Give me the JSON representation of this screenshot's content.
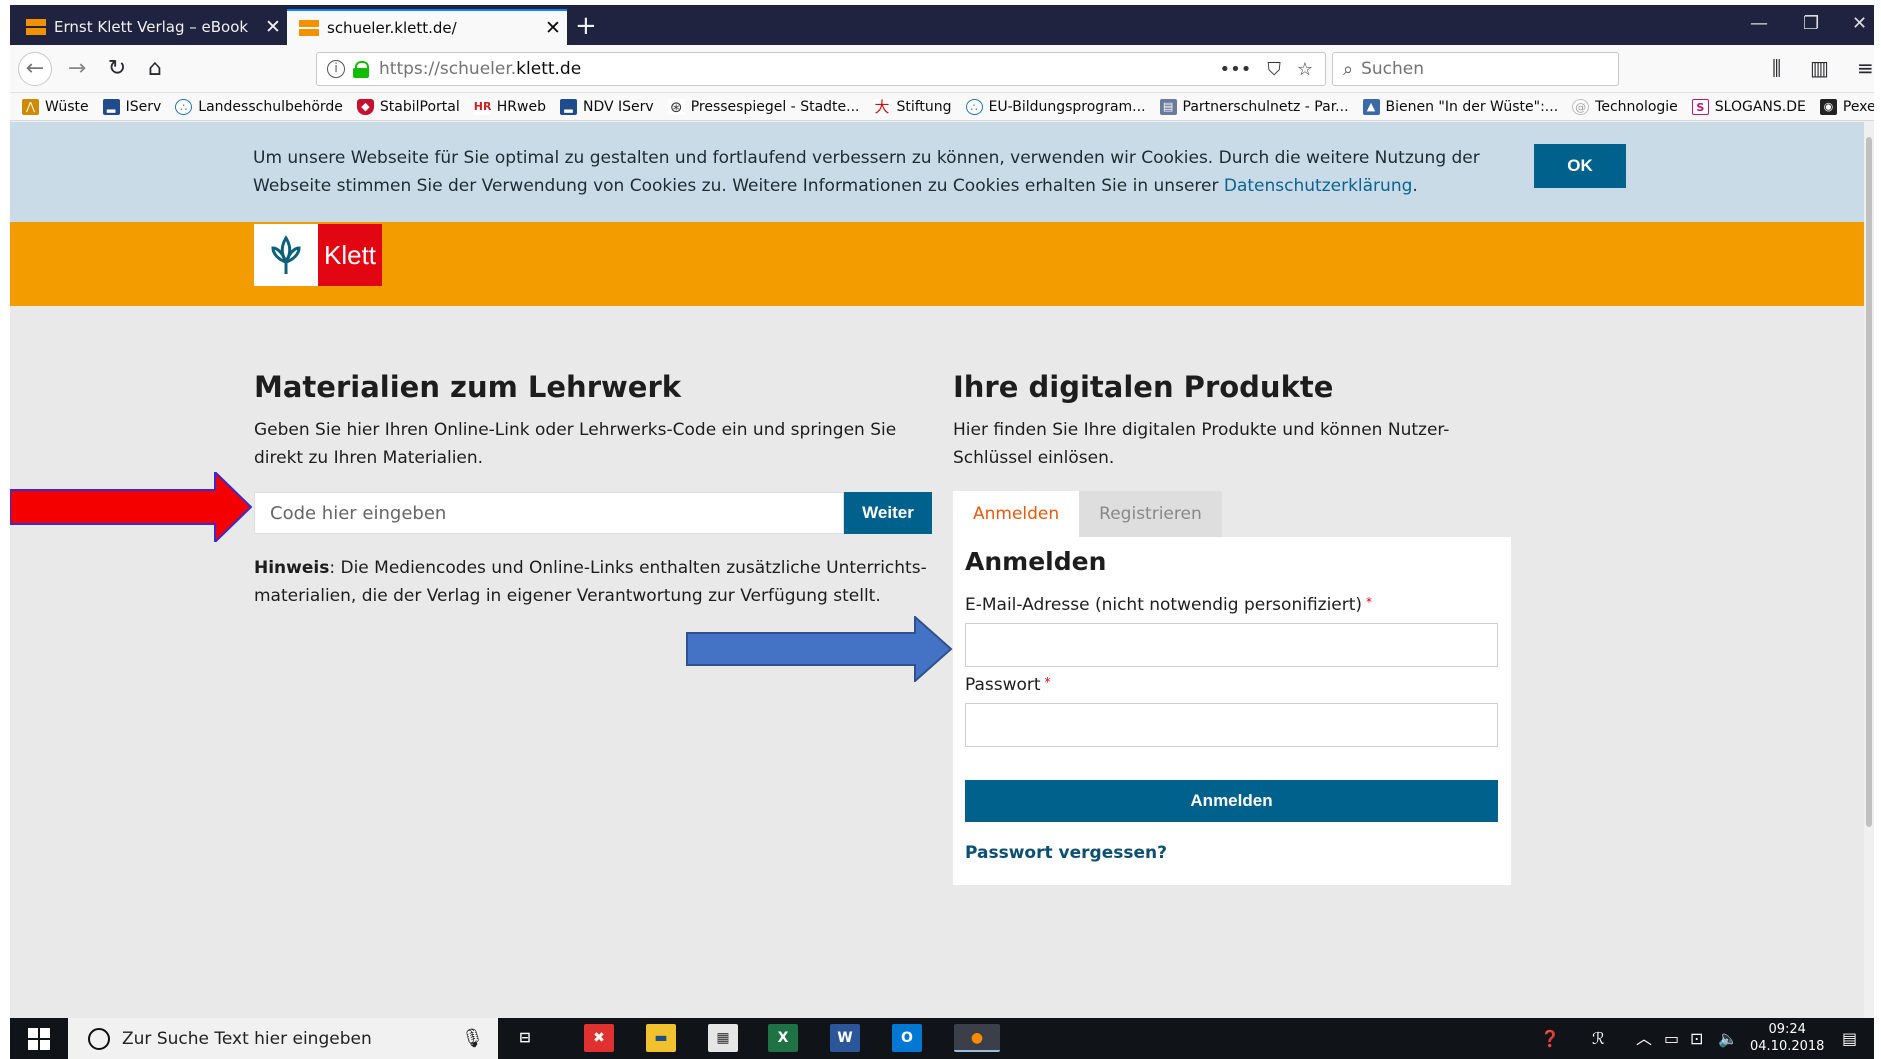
{
  "browser": {
    "tabs": [
      {
        "title": "Ernst Klett Verlag – eBook",
        "active": false
      },
      {
        "title": "schueler.klett.de/",
        "active": true
      }
    ],
    "url_prefix": "https://schueler.",
    "url_domain": "klett.de",
    "search_placeholder": "Suchen",
    "bookmarks": [
      {
        "label": "Wüste",
        "icon": "chart-icon",
        "color": "#d08a00"
      },
      {
        "label": "IServ",
        "icon": "iserv-icon",
        "color": "#1e4c8c"
      },
      {
        "label": "Landesschulbehörde",
        "icon": "circle-dots-icon",
        "color": "#1c71b8"
      },
      {
        "label": "StabilPortal",
        "icon": "shield-icon",
        "color": "#c8102e"
      },
      {
        "label": "HRweb",
        "icon": "hr-icon",
        "color": "#cc2222"
      },
      {
        "label": "NDV IServ",
        "icon": "iserv-icon",
        "color": "#1e4c8c"
      },
      {
        "label": "Pressespiegel - Stadte...",
        "icon": "globe-icon",
        "color": "#333333"
      },
      {
        "label": "Stiftung",
        "icon": "figure-icon",
        "color": "#d01010"
      },
      {
        "label": "EU-Bildungsprogram...",
        "icon": "circle-dots-icon",
        "color": "#1c71b8"
      },
      {
        "label": "Partnerschulnetz - Par...",
        "icon": "doc-icon",
        "color": "#6c7a99"
      },
      {
        "label": "Bienen \"In der Wüste\":...",
        "icon": "image-icon",
        "color": "#3a6aa8"
      },
      {
        "label": "Technologie",
        "icon": "tech-icon",
        "color": "#999999"
      },
      {
        "label": "SLOGANS.DE",
        "icon": "s-icon",
        "color": "#c2127a"
      },
      {
        "label": "Pexels",
        "icon": "camera-icon",
        "color": "#222222"
      }
    ]
  },
  "cookie": {
    "text": "Um unsere Webseite für Sie optimal zu gestalten und fortlaufend verbessern zu können, verwenden wir Cookies. Durch die weitere Nutzung der Webseite stimmen Sie der Verwendung von Cookies zu. Weitere Informationen zu Cookies erhalten Sie in unserer ",
    "link": "Datenschutzerklärung",
    "after": ".",
    "ok_label": "OK"
  },
  "brand": {
    "name": "Klett"
  },
  "left": {
    "heading": "Materialien zum Lehrwerk",
    "lead": "Geben Sie hier Ihren Online-Link oder Lehrwerks-Code ein und springen Sie direkt zu Ihren Materialien.",
    "code_placeholder": "Code hier eingeben",
    "button": "Weiter",
    "hint_bold": "Hinweis",
    "hint_text": ": Die Mediencodes und Online-Links enthalten zusätzliche Unterrichts-materialien, die der Verlag in eigener Verantwortung zur Verfügung stellt."
  },
  "right": {
    "heading": "Ihre digitalen Produkte",
    "lead": "Hier finden Sie Ihre digitalen Produkte und können Nutzer-Schlüssel einlösen.",
    "tab_login": "Anmelden",
    "tab_register": "Registrieren",
    "form_title": "Anmelden",
    "email_label": "E-Mail-Adresse (nicht notwendig personifiziert)",
    "password_label": "Passwort",
    "required_mark": "*",
    "submit": "Anmelden",
    "forgot": "Passwort vergessen?"
  },
  "taskbar": {
    "search_placeholder": "Zur Suche Text hier eingeben",
    "time": "09:24",
    "date": "04.10.2018"
  },
  "colors": {
    "accent_blue": "#00628c",
    "brand_orange": "#f39c00",
    "brand_red": "#e20613",
    "cookie_bg": "#c8dbe6"
  }
}
